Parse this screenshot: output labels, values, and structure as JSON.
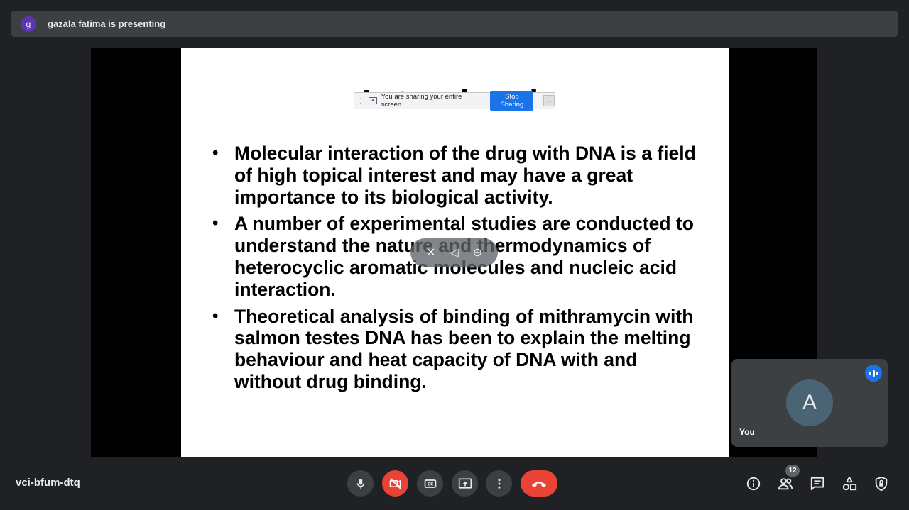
{
  "banner": {
    "presenter_initial": "g",
    "text": "gazala fatima is presenting"
  },
  "share_bar": {
    "message": "You are sharing your entire screen.",
    "stop_label": "Stop Sharing",
    "hide_label": "_"
  },
  "slide": {
    "title_partial": "Introduction",
    "bullets": [
      "Molecular interaction of the drug with DNA is a field of high topical interest and may have a great importance to its biological activity.",
      "A number of experimental studies are conducted to understand the nature and thermodynamics of heterocyclic aromatic molecules and nucleic acid interaction.",
      "Theoretical analysis of binding of mithramycin with salmon testes DNA has been to explain the melting behaviour and heat capacity of DNA with and without drug binding."
    ]
  },
  "self_tile": {
    "initial": "A",
    "label": "You"
  },
  "meeting": {
    "code": "vci-bfum-dtq",
    "participant_count": "12"
  },
  "colors": {
    "background": "#202124",
    "surface": "#3c4043",
    "danger": "#ea4335",
    "accent": "#1a73e8"
  },
  "icons": {
    "controls": [
      "mic-icon",
      "camera-off-icon",
      "captions-icon",
      "present-icon",
      "more-options-icon",
      "end-call-icon"
    ],
    "side": [
      "info-icon",
      "people-icon",
      "chat-icon",
      "activities-icon",
      "host-controls-icon"
    ]
  }
}
